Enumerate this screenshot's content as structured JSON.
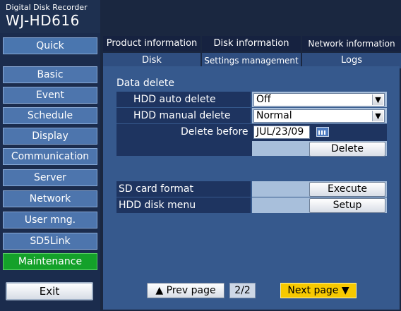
{
  "device": {
    "subtitle": "Digital Disk Recorder",
    "model": "WJ-HD616"
  },
  "sidebar": {
    "quick": "Quick",
    "items": [
      {
        "label": "Basic"
      },
      {
        "label": "Event"
      },
      {
        "label": "Schedule"
      },
      {
        "label": "Display"
      },
      {
        "label": "Communication"
      },
      {
        "label": "Server"
      },
      {
        "label": "Network"
      },
      {
        "label": "User mng."
      },
      {
        "label": "SD5Link"
      },
      {
        "label": "Maintenance",
        "active": true
      }
    ],
    "exit": "Exit"
  },
  "tabs": {
    "row1": [
      "Product information",
      "Disk information",
      "Network information"
    ],
    "row2": [
      "Disk",
      "Settings management",
      "Logs"
    ],
    "active": "Disk"
  },
  "data_delete": {
    "heading": "Data delete",
    "auto_delete_label": "HDD auto delete",
    "auto_delete_value": "Off",
    "manual_delete_label": "HDD manual delete",
    "manual_delete_value": "Normal",
    "delete_before_label": "Delete before",
    "delete_before_value": "JUL/23/09",
    "delete_button": "Delete"
  },
  "sd_card": {
    "label": "SD card format",
    "button": "Execute"
  },
  "hdd_menu": {
    "label": "HDD disk menu",
    "button": "Setup"
  },
  "pager": {
    "prev": "▲ Prev page",
    "indicator": "2/2",
    "next": "Next page ▼"
  },
  "colors": {
    "active_nav": "#14a12a",
    "next_button": "#f7c900",
    "panel": "#36598d"
  }
}
